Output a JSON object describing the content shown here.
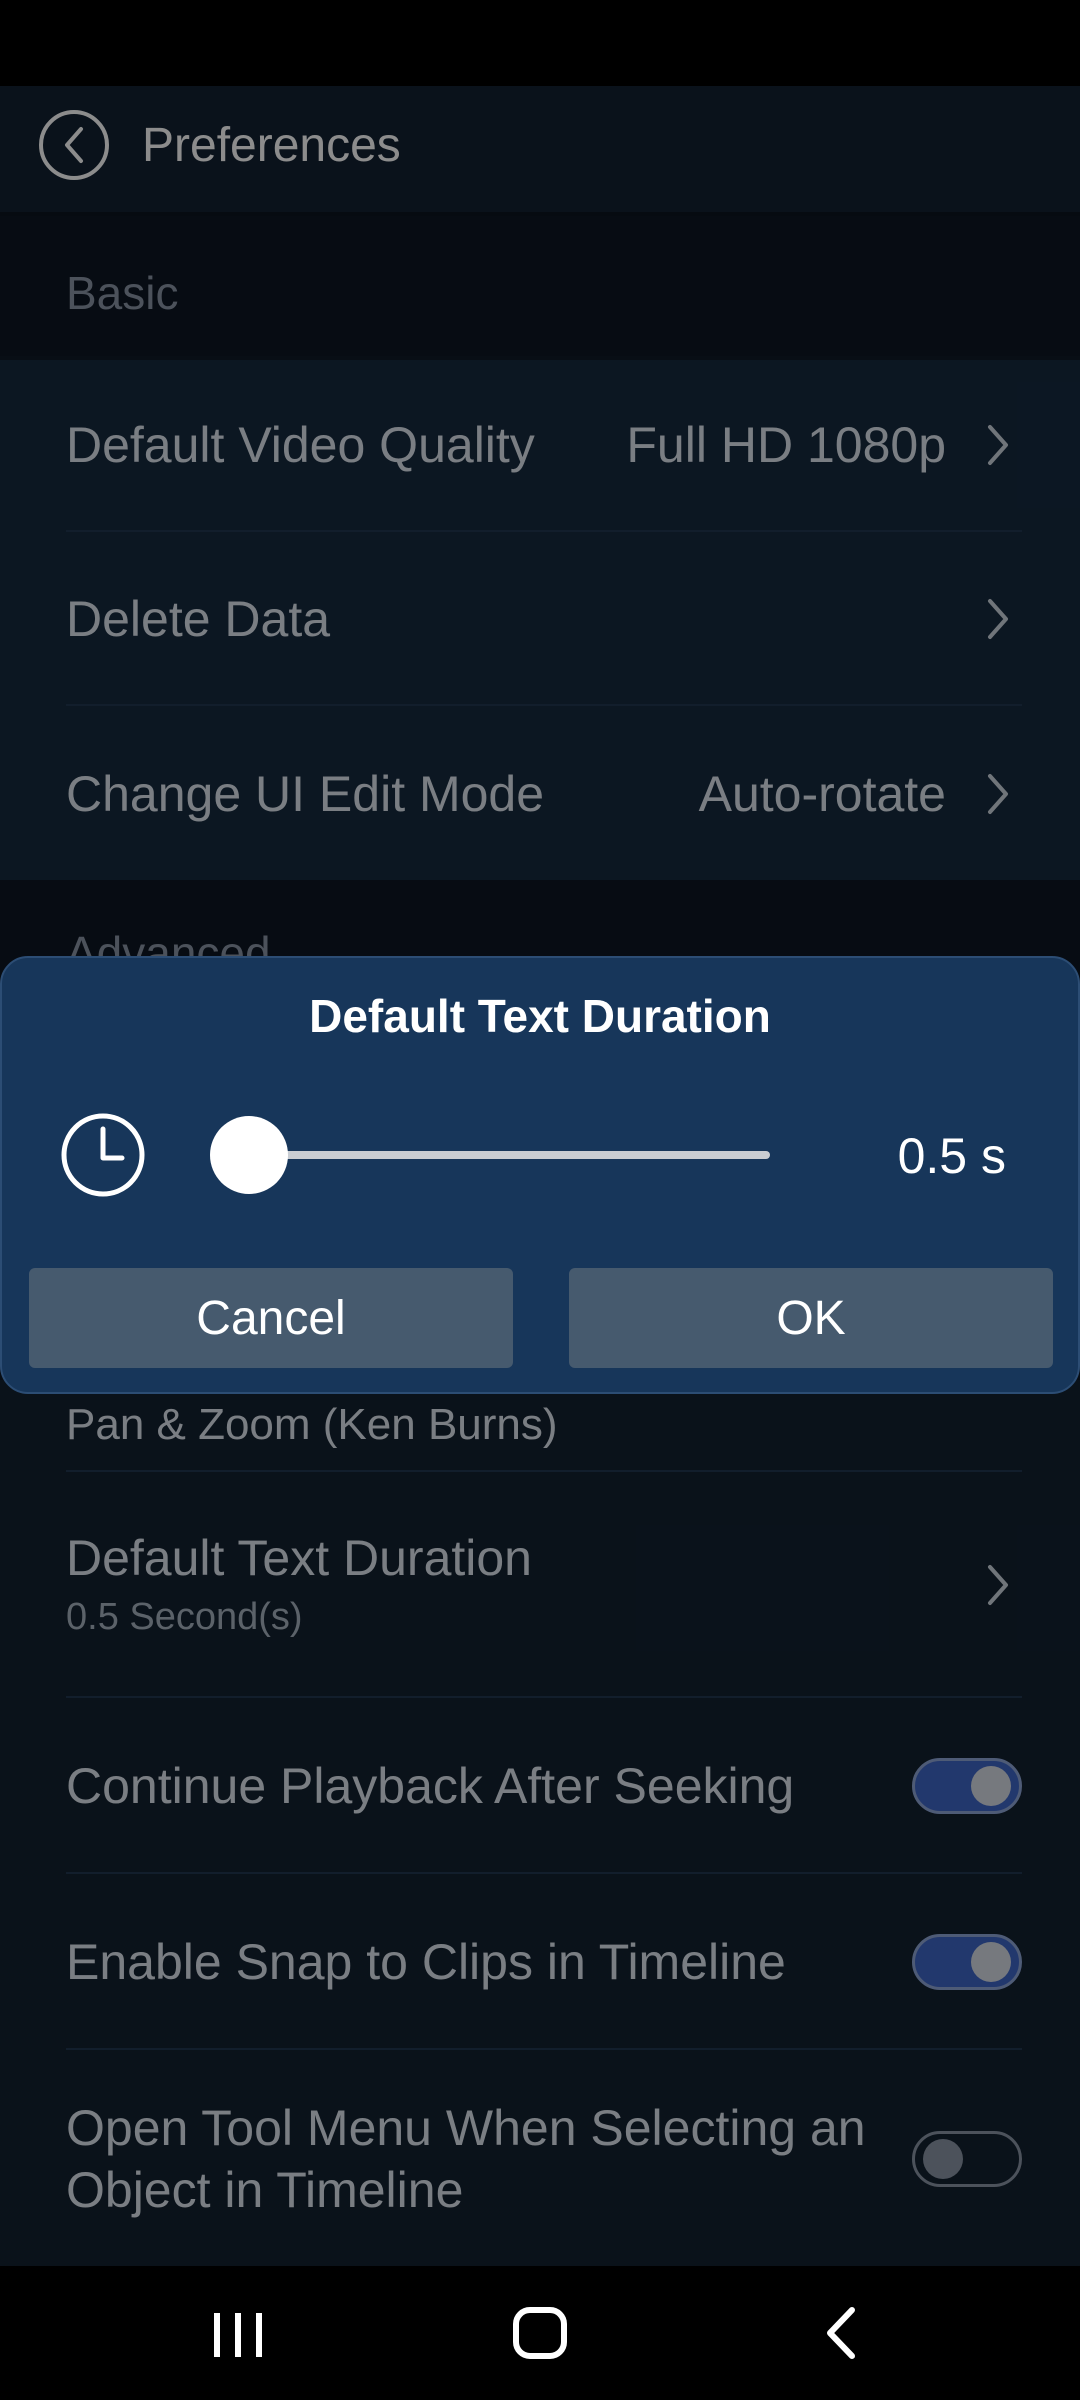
{
  "header": {
    "title": "Preferences",
    "back_icon": "back-icon"
  },
  "sections": {
    "basic": {
      "title": "Basic",
      "rows": [
        {
          "label": "Default Video Quality",
          "value": "Full HD 1080p"
        },
        {
          "label": "Delete Data",
          "value": ""
        },
        {
          "label": "Change UI Edit Mode",
          "value": "Auto-rotate"
        }
      ]
    },
    "advanced": {
      "title": "Advanced",
      "partial_row_label": "Pan & Zoom (Ken Burns)",
      "text_duration": {
        "label": "Default Text Duration",
        "sublabel": "0.5  Second(s)"
      },
      "toggles": [
        {
          "label": "Continue Playback After Seeking",
          "on": true
        },
        {
          "label": "Enable Snap to Clips in Timeline",
          "on": true
        },
        {
          "label": "Open Tool Menu When Selecting an Object in Timeline",
          "on": false
        }
      ]
    }
  },
  "dialog": {
    "title": "Default Text Duration",
    "value_label": "0.5 s",
    "slider_fraction": 0.0,
    "cancel_label": "Cancel",
    "ok_label": "OK"
  },
  "colors": {
    "background": "#0f1a27",
    "dialog": "#17365a",
    "toggle_on": "#3f66c6",
    "button": "#465a6e"
  }
}
